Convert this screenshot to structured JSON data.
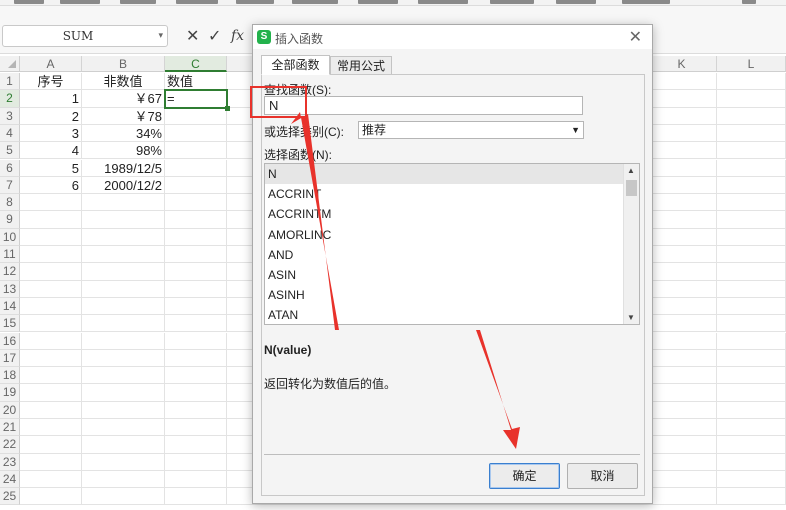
{
  "formula_bar": {
    "name_box_value": "SUM",
    "cancel_icon": "✕",
    "enter_icon": "✓",
    "fx_label": "fx"
  },
  "sheet": {
    "columns": [
      "A",
      "B",
      "C",
      "",
      "",
      "",
      "",
      "K",
      "L"
    ],
    "active_column": "C",
    "active_row": "2",
    "row_numbers": [
      "1",
      "2",
      "3",
      "4",
      "5",
      "6",
      "7",
      "8",
      "9",
      "10",
      "11",
      "12",
      "13",
      "14",
      "15",
      "16",
      "17",
      "18",
      "19",
      "20",
      "21",
      "22",
      "23",
      "24",
      "25"
    ],
    "rows": [
      {
        "a": "序号",
        "b": "非数值",
        "c": "数值"
      },
      {
        "a": "1",
        "b": "￥67",
        "c": "="
      },
      {
        "a": "2",
        "b": "￥78",
        "c": ""
      },
      {
        "a": "3",
        "b": "34%",
        "c": ""
      },
      {
        "a": "4",
        "b": "98%",
        "c": ""
      },
      {
        "a": "5",
        "b": "1989/12/5",
        "c": ""
      },
      {
        "a": "6",
        "b": "2000/12/2",
        "c": ""
      }
    ]
  },
  "dialog": {
    "logo_letter": "S",
    "title": "插入函数",
    "close_icon": "✕",
    "tabs": [
      "全部函数",
      "常用公式"
    ],
    "search_label": "查找函数(S):",
    "search_value": "N",
    "category_label": "或选择类别(C):",
    "category_value": "推荐",
    "list_label": "选择函数(N):",
    "functions": [
      "N",
      "ACCRINT",
      "ACCRINTM",
      "AMORLINC",
      "AND",
      "ASIN",
      "ASINH",
      "ATAN"
    ],
    "selected_function": "N",
    "signature": "N(value)",
    "description": "返回转化为数值后的值。",
    "ok_label": "确定",
    "cancel_label": "取消"
  },
  "annotation": {
    "color": "#e8322b"
  }
}
